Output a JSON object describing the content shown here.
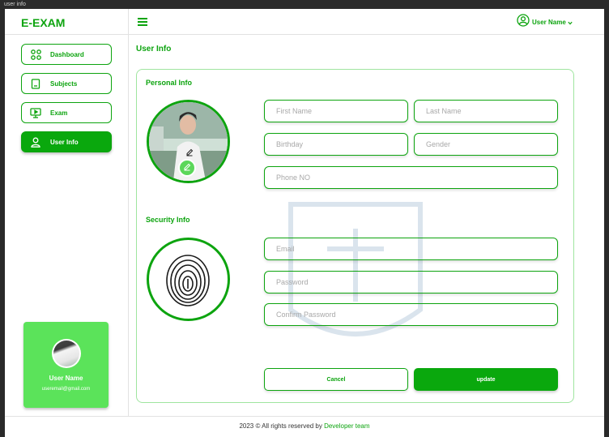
{
  "window": {
    "title": "user info"
  },
  "brand": {
    "name": "E-EXAM"
  },
  "sidebar": {
    "items": [
      {
        "label": "Dashboard",
        "icon": "grid-icon"
      },
      {
        "label": "Subjects",
        "icon": "book-icon"
      },
      {
        "label": "Exam",
        "icon": "presentation-icon"
      },
      {
        "label": "User Info",
        "icon": "user-icon",
        "active": true
      }
    ]
  },
  "user_card": {
    "name": "User Name",
    "email": "useremail@gmail.com"
  },
  "topbar": {
    "menu_icon": "hamburger-icon",
    "user_label": "User Name",
    "user_icon": "user-circle-icon",
    "dropdown_icon": "chevron-down-icon"
  },
  "page": {
    "title": "User Info"
  },
  "personal": {
    "title": "Personal Info",
    "first_name": "First Name",
    "last_name": "Last Name",
    "birthday": "Birthday",
    "gender": "Gender",
    "phone": "Phone NO"
  },
  "security": {
    "title": "Security Info",
    "email": "Email",
    "password": "Password",
    "confirm_password": "Confirm Password"
  },
  "actions": {
    "cancel": "Cancel",
    "update": "update"
  },
  "footer": {
    "text": "2023 © All rights reserved by ",
    "link": "Developer team"
  },
  "colors": {
    "accent": "#0da40f",
    "active_bg": "#0aa80d",
    "card_bg": "#5be35a"
  }
}
